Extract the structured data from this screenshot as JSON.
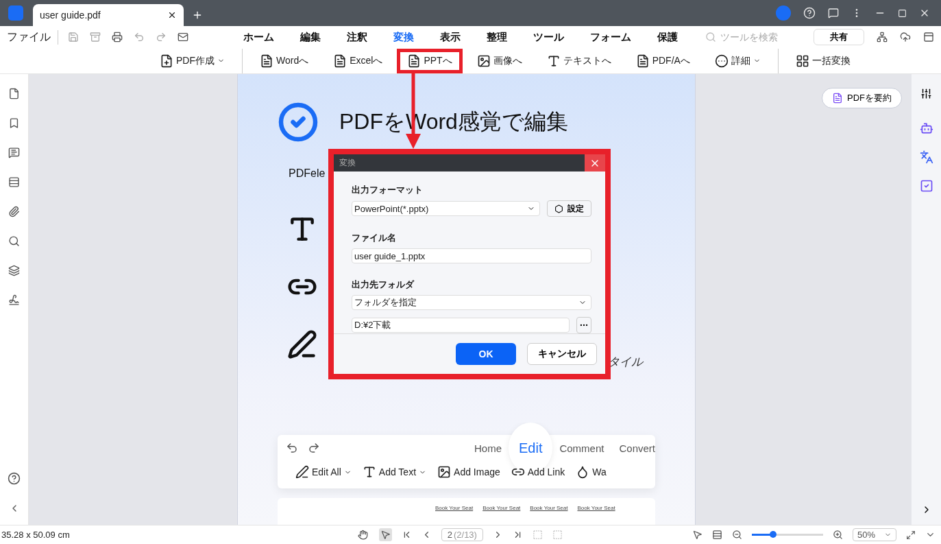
{
  "document_tab": {
    "title": "user guide.pdf"
  },
  "menu": {
    "file": "ファイル",
    "items": [
      {
        "label": "ホーム",
        "selected": false
      },
      {
        "label": "編集",
        "selected": false
      },
      {
        "label": "注釈",
        "selected": false
      },
      {
        "label": "変換",
        "selected": true
      },
      {
        "label": "表示",
        "selected": false
      },
      {
        "label": "整理",
        "selected": false
      },
      {
        "label": "ツール",
        "selected": false
      },
      {
        "label": "フォーム",
        "selected": false
      },
      {
        "label": "保護",
        "selected": false
      }
    ],
    "search": {
      "placeholder": "ツールを検索"
    },
    "share": "共有"
  },
  "ribbon": [
    [
      {
        "label": "PDF作成",
        "kind": "create",
        "dropdown": true,
        "highlighted": false
      }
    ],
    [
      {
        "label": "Wordへ",
        "kind": "word",
        "dropdown": false,
        "highlighted": false
      },
      {
        "label": "Excelへ",
        "kind": "excel",
        "dropdown": false,
        "highlighted": false
      },
      {
        "label": "PPTへ",
        "kind": "ppt",
        "dropdown": false,
        "highlighted": true
      },
      {
        "label": "画像へ",
        "kind": "image",
        "dropdown": false,
        "highlighted": false
      },
      {
        "label": "テキストへ",
        "kind": "text",
        "dropdown": false,
        "highlighted": false
      },
      {
        "label": "PDF/Aへ",
        "kind": "pdfa",
        "dropdown": false,
        "highlighted": false
      },
      {
        "label": "詳細",
        "kind": "more",
        "dropdown": true,
        "highlighted": false
      }
    ],
    [
      {
        "label": "一括変換",
        "kind": "batch",
        "dropdown": false,
        "highlighted": false
      }
    ]
  ],
  "page": {
    "heading": "PDFをWord感覚で編集",
    "intro": "PDFele",
    "side_text": "タイル",
    "screenshot": {
      "tabs": [
        {
          "label": "Home",
          "selected": false
        },
        {
          "label": "Edit",
          "selected": true
        },
        {
          "label": "Comment",
          "selected": false
        },
        {
          "label": "Convert",
          "selected": false
        }
      ],
      "tools": [
        {
          "label": "Edit All",
          "kind": "pen",
          "dropdown": true
        },
        {
          "label": "Add Text",
          "kind": "text",
          "dropdown": true
        },
        {
          "label": "Add Image",
          "kind": "image",
          "dropdown": false
        },
        {
          "label": "Add Link",
          "kind": "link",
          "dropdown": false
        },
        {
          "label": "Wa",
          "kind": "drop",
          "dropdown": false
        }
      ],
      "preview_links": [
        "Book Your Seat",
        "Book Your Seat",
        "Book Your Seat",
        "Book Your Seat"
      ]
    }
  },
  "dialog": {
    "title": "変換",
    "highlighted": true,
    "format_label": "出力フォーマット",
    "format": "PowerPoint(*.pptx)",
    "settings": "設定",
    "filename_label": "ファイル名",
    "filename": "user guide_1.pptx",
    "folder_label": "出力先フォルダ",
    "folder_mode": "フォルダを指定",
    "path": "D:¥2下載",
    "ok": "OK",
    "cancel": "キャンセル"
  },
  "summarize": "PDFを要約",
  "status_bar": {
    "dimensions": "35.28 x 50.09 cm",
    "tools": [
      {
        "kind": "hand",
        "selected": false
      },
      {
        "kind": "select",
        "selected": true
      }
    ],
    "page": "2",
    "page_count": "(2/13)",
    "zoom": {
      "level": 0.3
    },
    "zoom_value": "50%"
  }
}
